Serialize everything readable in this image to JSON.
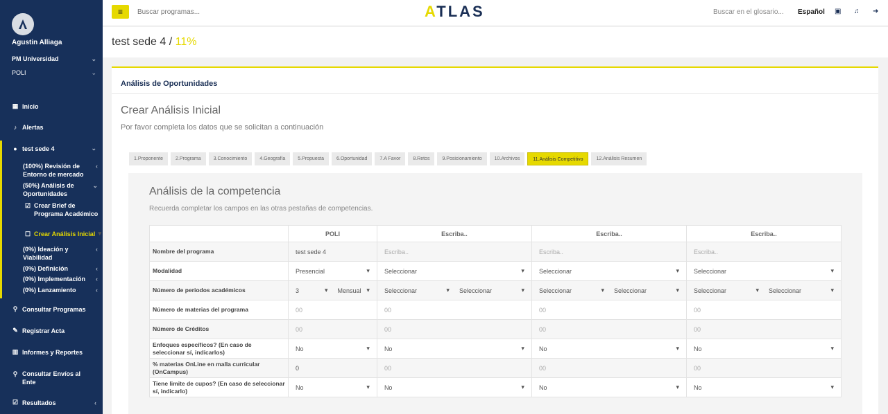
{
  "user": {
    "name": "Agustin Alliaga"
  },
  "org": {
    "university": "PM Universidad",
    "campus": "POLI"
  },
  "nav": {
    "inicio": "Inicio",
    "alertas": "Alertas",
    "project": "test sede 4",
    "sub1": "(100%) Revisión de Entorno de mercado",
    "sub2": "(50%) Análisis de Oportunidades",
    "sub3": "Crear Brief de Programa Académico",
    "sub4": "Crear Análisis Inicial",
    "sub5": "(0%) Ideación y Viabilidad",
    "sub6": "(0%) Definición",
    "sub7": "(0%) Implementación",
    "sub8": "(0%) Lanzamiento",
    "consultar": "Consultar Programas",
    "registrar": "Registrar Acta",
    "informes": "Informes y Reportes",
    "envios": "Consultar Envíos al Ente",
    "resultados": "Resultados"
  },
  "topbar": {
    "search_placeholder": "Buscar programas...",
    "logo_a": "A",
    "logo_rest": "TLAS",
    "glossary": "Buscar en el glosario...",
    "lang": "Español"
  },
  "page": {
    "title": "test sede 4 / ",
    "pct": "11%"
  },
  "card": {
    "header": "Análisis de Oportunidades",
    "title": "Crear Análisis Inicial",
    "lead": "Por favor completa los datos que se solicitan a continuación"
  },
  "tabs": [
    "1.Proponente",
    "2.Programa",
    "3.Conocimiento",
    "4.Geografía",
    "5.Propuesta",
    "6.Oportunidad",
    "7.A Favor",
    "8.Retos",
    "9.Posicionamiento",
    "10.Archivos",
    "11.Análisis Competitivo",
    "12.Análisis Resumen"
  ],
  "panel": {
    "title": "Análisis de la competencia",
    "lead": "Recuerda completar los campos en las otras pestañas de competencias."
  },
  "table": {
    "headers": [
      "POLI",
      "Escriba..",
      "Escriba..",
      "Escriba.."
    ],
    "labels": [
      "Nombre del programa",
      "Modalidad",
      "Número de periodos académicos",
      "Número de materias del programa",
      "Número de Créditos",
      "Enfoques específicos? (En caso de seleccionar sí, indicarlos)",
      "% materias OnLine en malla curricular (OnCampus)",
      "Tiene limite de cupos? (En caso de seleccionar sí, indicarlo)"
    ],
    "poli": {
      "name": "test sede 4",
      "modalidad": "Presencial",
      "periodos": "3",
      "tipo": "Mensual",
      "materias": "00",
      "creditos": "00",
      "enfoques": "No",
      "online": "0",
      "cupos": "No"
    },
    "other": {
      "name": "Escriba..",
      "select": "Seleccionar",
      "num": "00",
      "no": "No"
    }
  }
}
